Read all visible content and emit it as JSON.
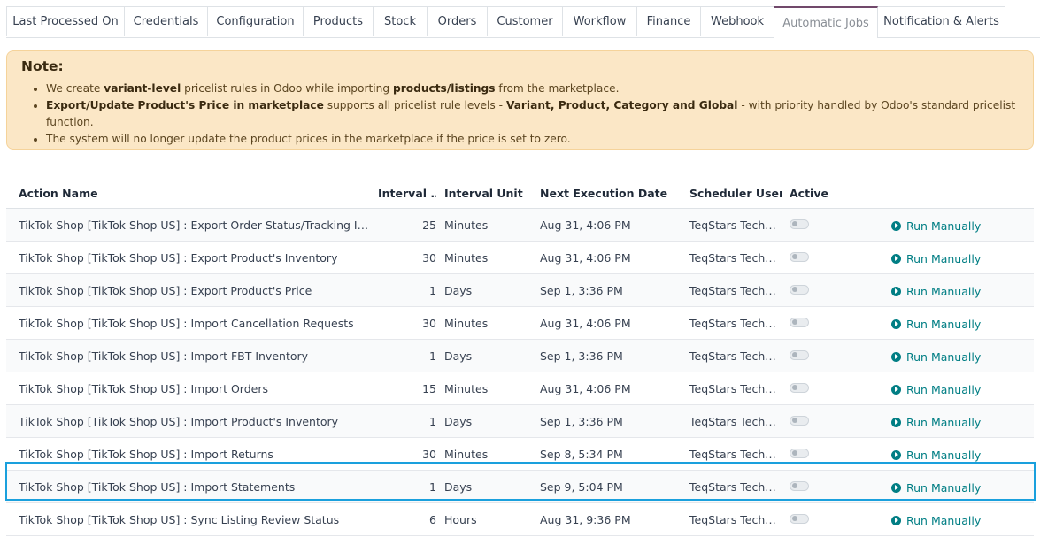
{
  "tabs": [
    {
      "label": "Last Processed On",
      "active": false
    },
    {
      "label": "Credentials",
      "active": false
    },
    {
      "label": "Configuration",
      "active": false
    },
    {
      "label": "Products",
      "active": false
    },
    {
      "label": "Stock",
      "active": false
    },
    {
      "label": "Orders",
      "active": false
    },
    {
      "label": "Customer",
      "active": false
    },
    {
      "label": "Workflow",
      "active": false
    },
    {
      "label": "Finance",
      "active": false
    },
    {
      "label": "Webhook",
      "active": false
    },
    {
      "label": "Automatic Jobs",
      "active": true
    },
    {
      "label": "Notification & Alerts",
      "active": false
    }
  ],
  "note": {
    "title": "Note:",
    "items": [
      [
        {
          "t": "We create "
        },
        {
          "t": "variant-level",
          "b": true
        },
        {
          "t": " pricelist rules in Odoo while importing "
        },
        {
          "t": "products/listings",
          "b": true
        },
        {
          "t": " from the marketplace."
        }
      ],
      [
        {
          "t": "Export/Update Product's Price in marketplace",
          "b": true
        },
        {
          "t": " supports all pricelist rule levels - "
        },
        {
          "t": "Variant, Product, Category and Global",
          "b": true
        },
        {
          "t": " - with priority handled by Odoo's standard pricelist function."
        }
      ],
      [
        {
          "t": "The system will no longer update the product prices in the marketplace if the price is set to zero."
        }
      ]
    ]
  },
  "table": {
    "headers": {
      "name": "Action Name",
      "interval": "Interval ...",
      "unit": "Interval Unit",
      "next": "Next Execution Date",
      "user": "Scheduler User",
      "active": "Active"
    },
    "run_label": "Run Manually",
    "rows": [
      {
        "name": "TikTok Shop [TikTok Shop US] : Export Order Status/Tracking Informa...",
        "interval": "25",
        "unit": "Minutes",
        "next": "Aug 31, 4:06 PM",
        "user": "TeqStars Techn...",
        "active": false
      },
      {
        "name": "TikTok Shop [TikTok Shop US] : Export Product's Inventory",
        "interval": "30",
        "unit": "Minutes",
        "next": "Aug 31, 4:06 PM",
        "user": "TeqStars Techn...",
        "active": false
      },
      {
        "name": "TikTok Shop [TikTok Shop US] : Export Product's Price",
        "interval": "1",
        "unit": "Days",
        "next": "Sep 1, 3:36 PM",
        "user": "TeqStars Techn...",
        "active": false
      },
      {
        "name": "TikTok Shop [TikTok Shop US] : Import Cancellation Requests",
        "interval": "30",
        "unit": "Minutes",
        "next": "Aug 31, 4:06 PM",
        "user": "TeqStars Techn...",
        "active": false
      },
      {
        "name": "TikTok Shop [TikTok Shop US] : Import FBT Inventory",
        "interval": "1",
        "unit": "Days",
        "next": "Sep 1, 3:36 PM",
        "user": "TeqStars Techn...",
        "active": false
      },
      {
        "name": "TikTok Shop [TikTok Shop US] : Import Orders",
        "interval": "15",
        "unit": "Minutes",
        "next": "Aug 31, 4:06 PM",
        "user": "TeqStars Techn...",
        "active": false
      },
      {
        "name": "TikTok Shop [TikTok Shop US] : Import Product's Inventory",
        "interval": "1",
        "unit": "Days",
        "next": "Sep 1, 3:36 PM",
        "user": "TeqStars Techn...",
        "active": false
      },
      {
        "name": "TikTok Shop [TikTok Shop US] : Import Returns",
        "interval": "30",
        "unit": "Minutes",
        "next": "Sep 8, 5:34 PM",
        "user": "TeqStars Techn...",
        "active": false
      },
      {
        "name": "TikTok Shop [TikTok Shop US] : Import Statements",
        "interval": "1",
        "unit": "Days",
        "next": "Sep 9, 5:04 PM",
        "user": "TeqStars Techn...",
        "active": false,
        "highlighted": true
      },
      {
        "name": "TikTok Shop [TikTok Shop US] : Sync Listing Review Status",
        "interval": "6",
        "unit": "Hours",
        "next": "Aug 31, 9:36 PM",
        "user": "TeqStars Techn...",
        "active": false
      }
    ]
  },
  "colors": {
    "accent": "#017e84",
    "tab_active_border": "#71496b",
    "note_bg": "#fbe7c6",
    "highlight": "#1aa0dd"
  }
}
